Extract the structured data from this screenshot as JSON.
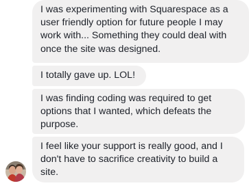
{
  "conversation": {
    "messages": [
      {
        "text": "I was experimenting with Squarespace as a\nuser friendly option for future people I may\nwork with... Something they could deal with\nonce the site was designed."
      },
      {
        "text": "I totally gave up. LOL!"
      },
      {
        "text": "I was finding coding was required to get\noptions that I wanted, which defeats the\npurpose."
      },
      {
        "text": "I feel like your support is really good, and I\ndon't have to sacrifice creativity to build a\nsite."
      }
    ]
  },
  "colors": {
    "bubble_background": "#f1f0f0",
    "text": "#1d2129",
    "page_background": "#ffffff"
  },
  "icons": {
    "avatar": "sender-avatar-photo"
  }
}
